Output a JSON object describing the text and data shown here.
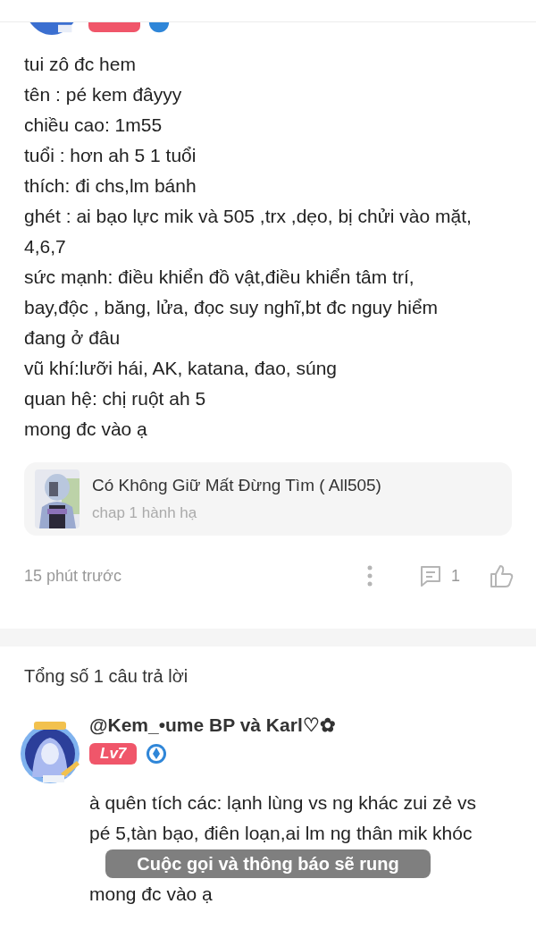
{
  "post": {
    "author_level_badge": {
      "cut": true
    },
    "lines": [
      "tui zô đc hem",
      "tên : pé kem đâyyy",
      "chiều cao: 1m55",
      "tuổi : hơn ah 5 1 tuổi",
      "thích: đi chs,lm bánh",
      "ghét : ai bạo lực mik và 505 ,trx ,dẹo, bị chửi vào mặt,",
      "4,6,7",
      "sức mạnh: điều khiển đồ vật,điều khiển tâm trí,",
      "bay,độc , băng, lửa, đọc suy nghĩ,bt đc nguy hiểm",
      "đang ở đâu",
      "vũ khí:lưỡi hái, AK, katana, đao, súng",
      "quan hệ: chị ruột ah 5",
      "mong đc vào ạ"
    ],
    "quote": {
      "title": "Có Không Giữ Mất Đừng Tìm ( All505)",
      "subtitle": "chap 1 hành hạ"
    },
    "time": "15 phút trước",
    "comment_count": "1"
  },
  "replies_header": "Tổng số 1 câu trả lời",
  "replies": [
    {
      "author": "@Kem_•ume BP và Karl♡✿",
      "level": "Lv7",
      "lines": [
        "à quên tích các: lạnh lùng vs ng khác zui zẻ vs",
        "pé 5,tàn bạo, điên loạn,ai lm ng thân mik khóc",
        "mong đc vào ạ"
      ]
    }
  ],
  "toast": "Cuộc gọi và thông báo sẽ rung"
}
